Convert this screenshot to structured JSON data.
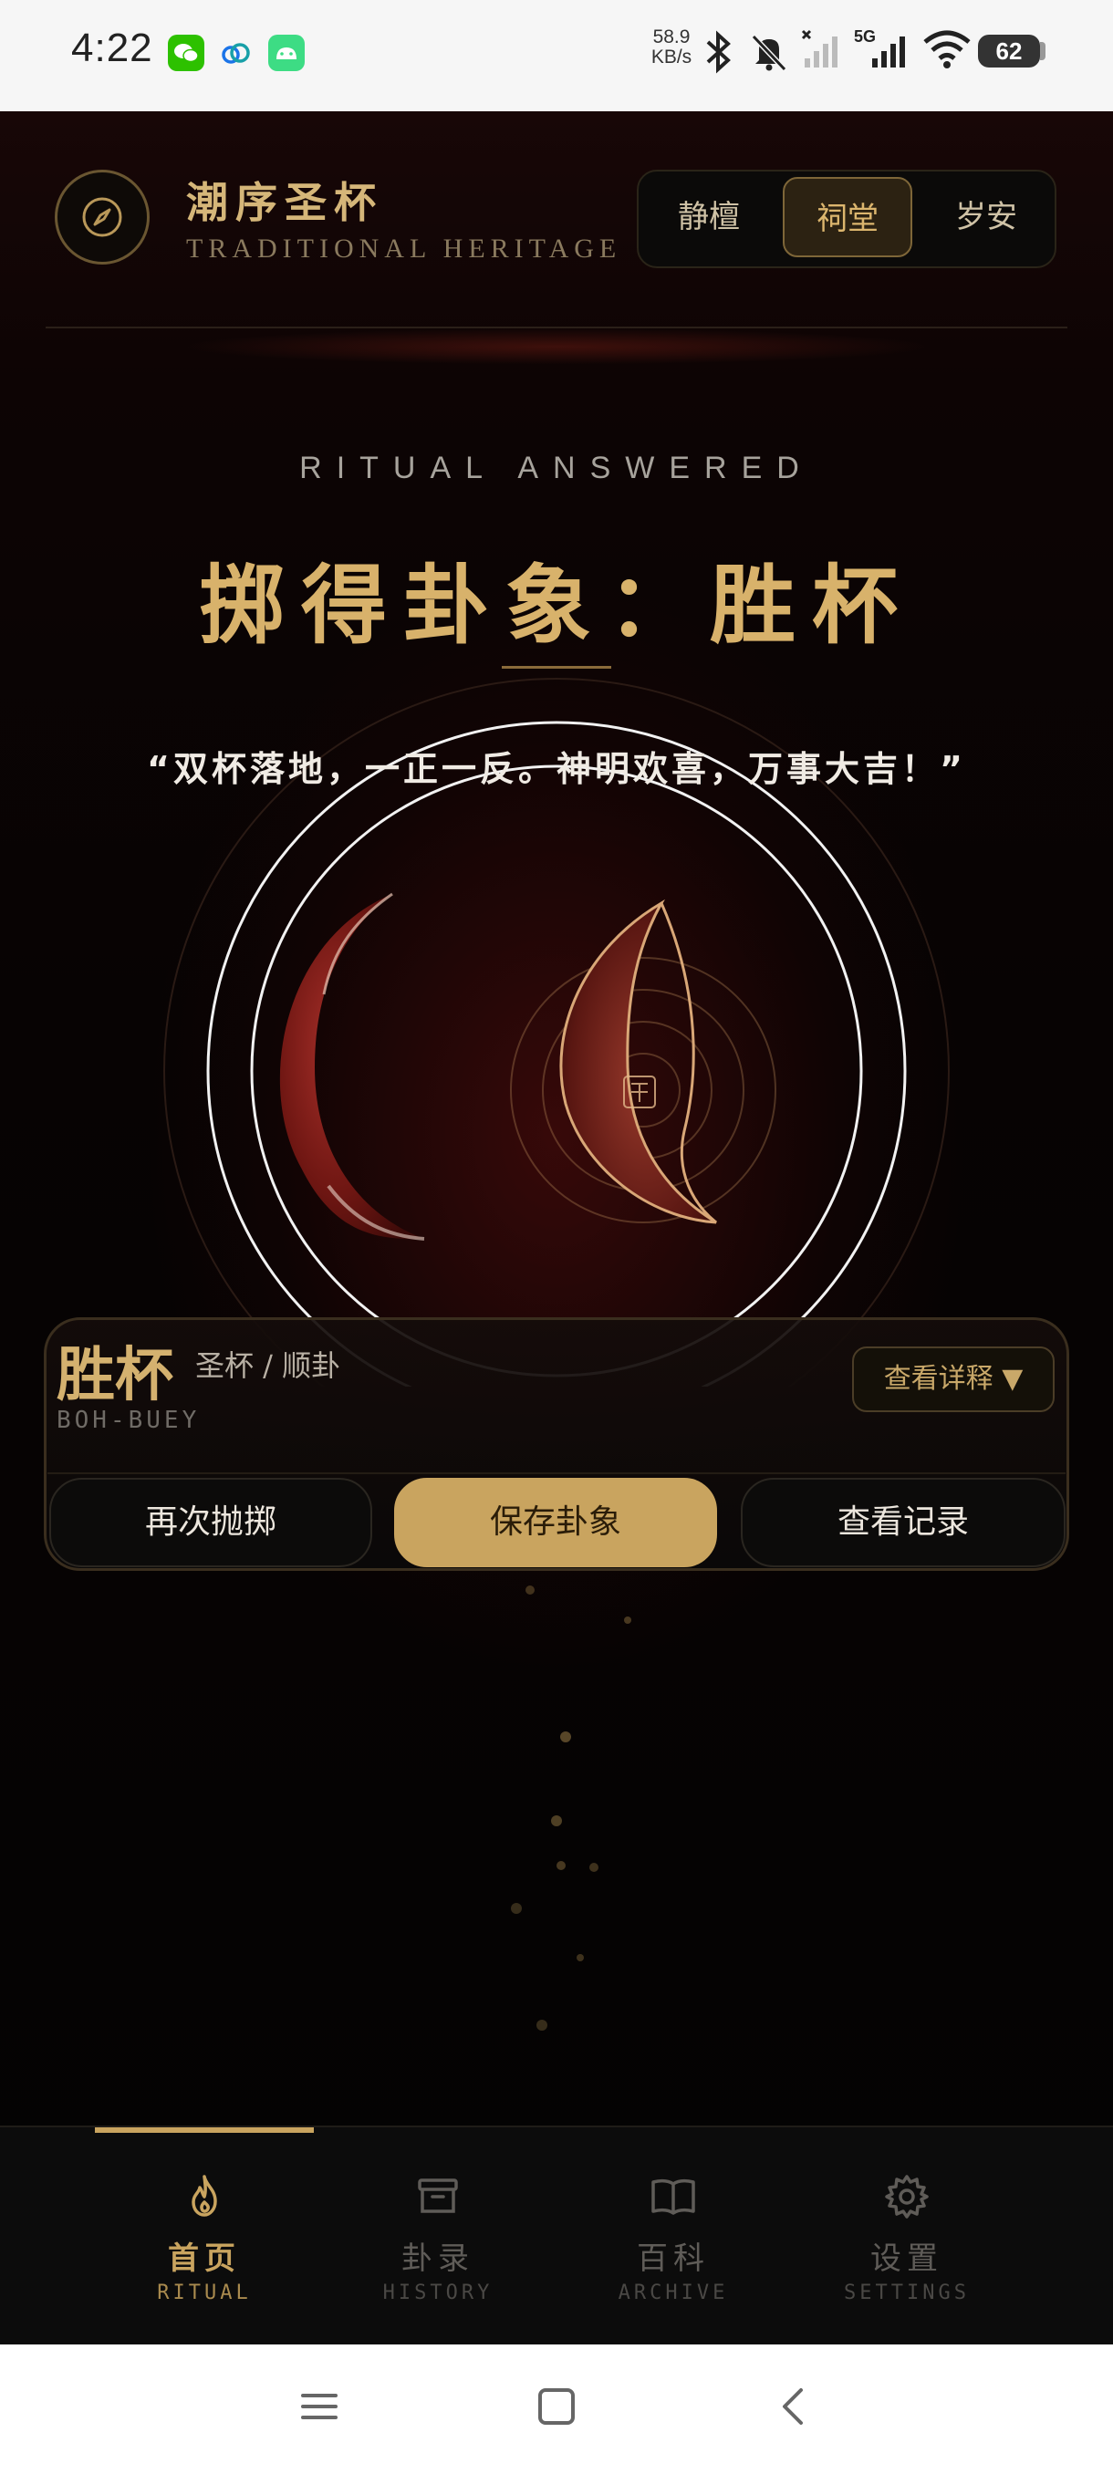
{
  "status_bar": {
    "time": "4:22",
    "net_speed_value": "58.9",
    "net_speed_unit": "KB/s",
    "network": "5G",
    "battery": "62"
  },
  "header": {
    "title": "潮序圣杯",
    "subtitle": "TRADITIONAL HERITAGE",
    "logo_icon": "compass-icon",
    "tabs": [
      {
        "label": "静檀",
        "active": false
      },
      {
        "label": "祠堂",
        "active": true
      },
      {
        "label": "岁安",
        "active": false
      }
    ]
  },
  "hero": {
    "eyebrow": "RITUAL ANSWERED",
    "headline": "掷得卦象：胜杯",
    "quote": "“双杯落地，一正一反。神明欢喜，万事大吉！”"
  },
  "result": {
    "name": "胜杯",
    "alias": "圣杯 / 顺卦",
    "romanization": "BOH-BUEY",
    "detail_button": "查看详释 ▼"
  },
  "actions": {
    "retry": "再次抛掷",
    "save": "保存卦象",
    "history": "查看记录"
  },
  "nav": [
    {
      "label": "首页",
      "sub": "RITUAL",
      "icon": "flame-icon",
      "active": true
    },
    {
      "label": "卦录",
      "sub": "HISTORY",
      "icon": "archive-box-icon",
      "active": false
    },
    {
      "label": "百科",
      "sub": "ARCHIVE",
      "icon": "open-book-icon",
      "active": false
    },
    {
      "label": "设置",
      "sub": "SETTINGS",
      "icon": "gear-icon",
      "active": false
    }
  ],
  "colors": {
    "gold": "#c9a45f",
    "deep_red": "#7a1a14",
    "background": "#050505"
  }
}
